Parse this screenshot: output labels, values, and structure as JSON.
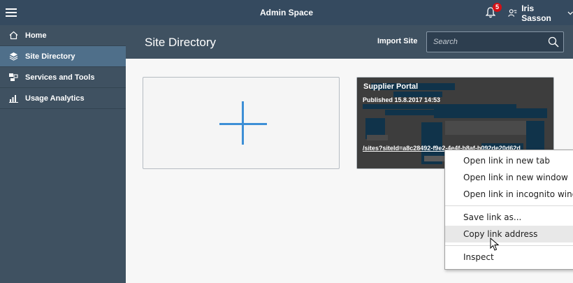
{
  "shell": {
    "title": "Admin Space",
    "notifications_count": "5",
    "user_name": "Iris Sasson"
  },
  "sidebar": {
    "items": [
      {
        "label": "Home",
        "icon": "home-icon"
      },
      {
        "label": "Site Directory",
        "icon": "site-directory-icon",
        "active": true
      },
      {
        "label": "Services and Tools",
        "icon": "services-tools-icon"
      },
      {
        "label": "Usage Analytics",
        "icon": "analytics-icon"
      }
    ]
  },
  "header": {
    "title": "Site Directory",
    "import_label": "Import Site",
    "search_placeholder": "Search"
  },
  "tiles": {
    "site": {
      "name": "Supplier Portal",
      "published": "Published 15.8.2017 14:53",
      "link": "/sites?siteId=a8c28492-f9e2-4e4f-b8af-b092de20d62d"
    }
  },
  "context_menu": {
    "items": [
      "Open link in new tab",
      "Open link in new window",
      "Open link in incognito window",
      "Save link as...",
      "Copy link address",
      "Inspect"
    ]
  },
  "colors": {
    "shell": "#354a5f",
    "sidebar": "#3f5161",
    "active": "#4f6f8a",
    "accent": "#3d8fd6",
    "badge": "#d21016"
  }
}
